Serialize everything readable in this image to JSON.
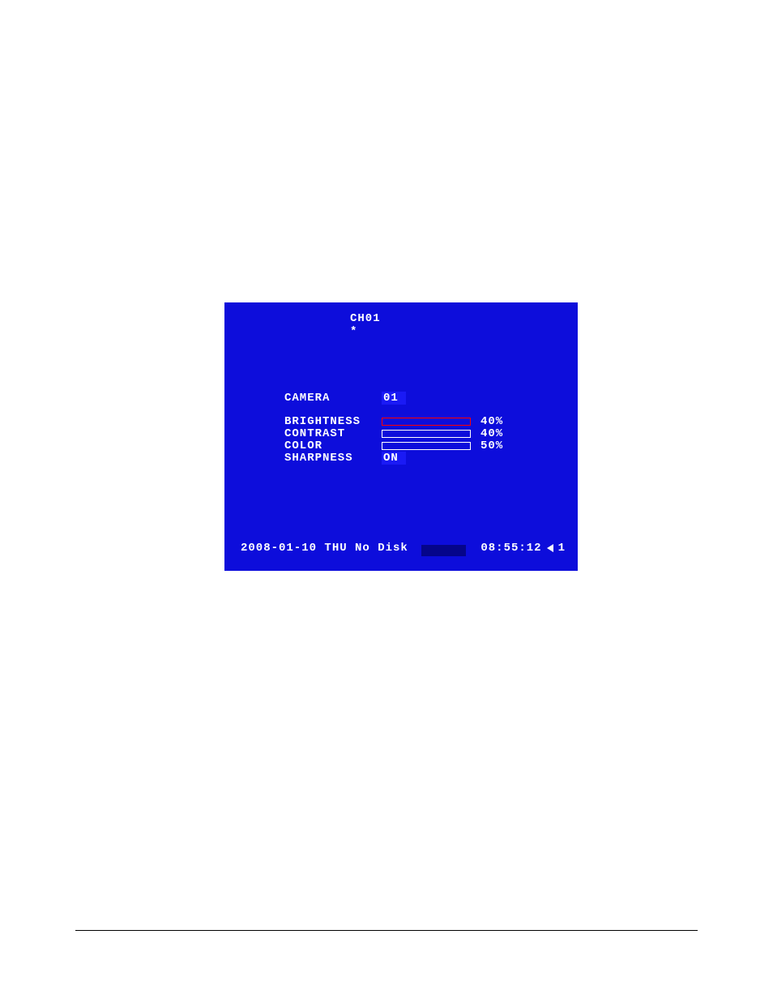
{
  "header": {
    "channel": "CH01",
    "asterisk": "*"
  },
  "settings": {
    "camera": {
      "label": "CAMERA",
      "value": "01"
    },
    "brightness": {
      "label": "BRIGHTNESS",
      "percent": "40%",
      "fill": 40
    },
    "contrast": {
      "label": "CONTRAST",
      "percent": "40%",
      "fill": 40
    },
    "color": {
      "label": "COLOR",
      "percent": "50%",
      "fill": 50
    },
    "sharpness": {
      "label": "SHARPNESS",
      "value": "ON"
    }
  },
  "status": {
    "datetime": "2008-01-10 THU No Disk",
    "time": "08:55:12",
    "audio_channel": "1"
  }
}
